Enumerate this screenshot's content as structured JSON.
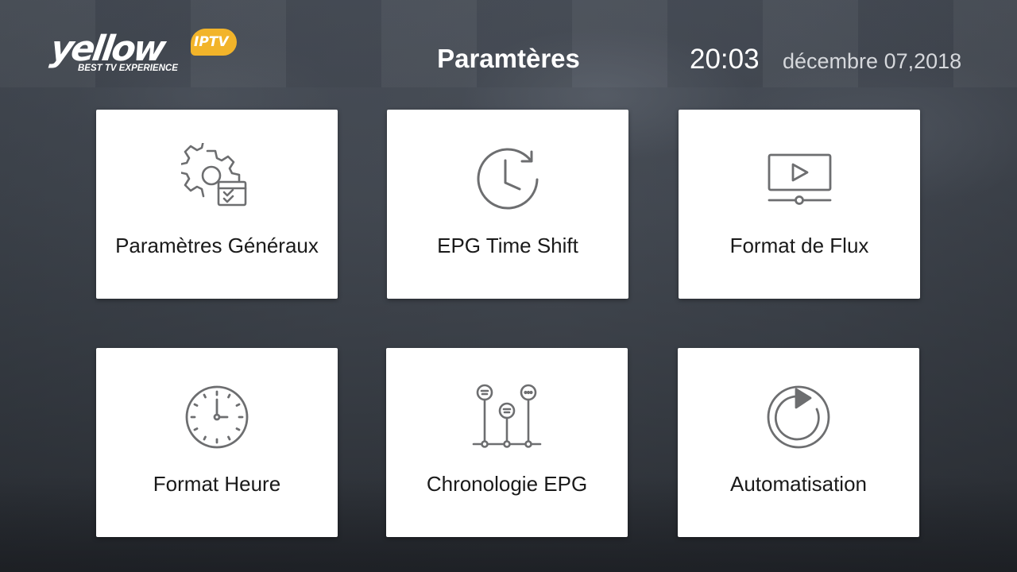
{
  "header": {
    "logo": {
      "word": "yellow",
      "badge": "IPTV",
      "tagline": "BEST TV EXPERIENCE",
      "badge_color": "#f2b42a"
    },
    "title": "Paramtères",
    "time": "20:03",
    "date": "décembre 07,2018"
  },
  "tiles": [
    {
      "label": "Paramètres Généraux",
      "icon": "gear-settings-icon"
    },
    {
      "label": "EPG Time Shift",
      "icon": "clock-refresh-icon"
    },
    {
      "label": "Format de Flux",
      "icon": "video-player-icon"
    },
    {
      "label": "Format Heure",
      "icon": "clock-icon"
    },
    {
      "label": "Chronologie EPG",
      "icon": "timeline-icon"
    },
    {
      "label": "Automatisation",
      "icon": "replay-icon"
    }
  ],
  "colors": {
    "tile_background": "#ffffff",
    "icon_stroke": "#6d6e70",
    "text": "#1a1a1a"
  }
}
